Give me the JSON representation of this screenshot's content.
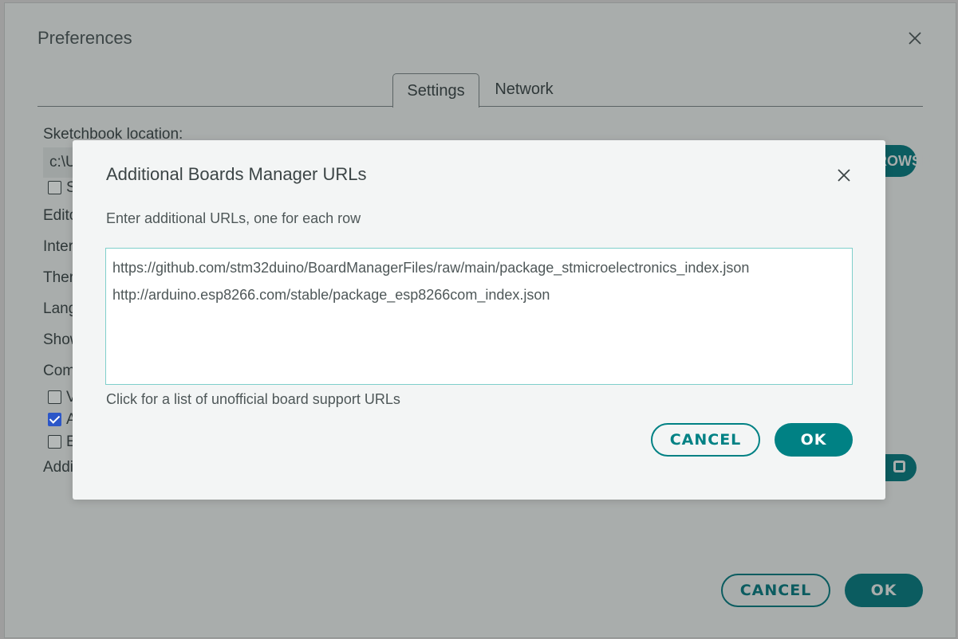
{
  "background_dialog": {
    "title": "Preferences",
    "tabs": [
      {
        "label": "Settings",
        "active": true
      },
      {
        "label": "Network",
        "active": false
      }
    ],
    "sketchbook_label": "Sketchbook location:",
    "sketchbook_value": "c:\\U",
    "browse_label": "BROWSE",
    "partial_labels": {
      "show_files": "S",
      "editor": "Edito",
      "interface": "Inter",
      "theme": "Ther",
      "language": "Lang",
      "show_verbose": "Show",
      "compiler": "Com",
      "verify": "V",
      "auto_save": "A",
      "editor_quick": "E",
      "additional": "Addi"
    },
    "checkboxes": {
      "show_files": false,
      "verify": false,
      "auto_save": true,
      "editor_quick": false
    },
    "cancel_label": "CANCEL",
    "ok_label": "OK"
  },
  "modal": {
    "title": "Additional Boards Manager URLs",
    "description": "Enter additional URLs, one for each row",
    "urls": [
      "https://github.com/stm32duino/BoardManagerFiles/raw/main/package_stmicroelectronics_index.json",
      "http://arduino.esp8266.com/stable/package_esp8266com_index.json"
    ],
    "help_link": "Click for a list of unofficial board support URLs",
    "cancel_label": "CANCEL",
    "ok_label": "OK"
  },
  "colors": {
    "accent": "#008184",
    "accent_dimmed": "#0b5c60",
    "overlay_gray": "#a9adac",
    "modal_bg": "#f3f5f5",
    "checkbox_checked": "#2b56c8"
  },
  "icons": {
    "close": "close-icon",
    "url-editor": "url-editor-icon"
  }
}
